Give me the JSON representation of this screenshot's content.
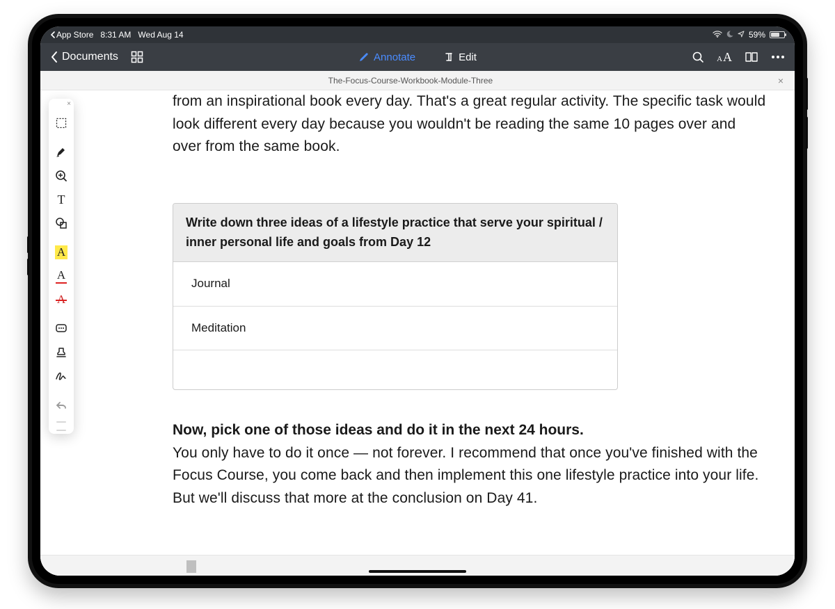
{
  "status": {
    "back_app": "App Store",
    "time": "8:31 AM",
    "date": "Wed Aug 14",
    "battery_pct": "59%"
  },
  "nav": {
    "back_label": "Documents",
    "annotate_label": "Annotate",
    "edit_label": "Edit"
  },
  "tab": {
    "title": "The-Focus-Course-Workbook-Module-Three"
  },
  "doc": {
    "p1": "from an inspirational book every day. That's a great regular activity. The specific task would look different every day because you wouldn't be reading the same 10 pages over and over from the same book.",
    "table_header": "Write down three ideas of a lifestyle practice that serve your spiritual / inner personal life and goals from Day 12",
    "rows": [
      "Journal",
      "Meditation",
      ""
    ],
    "bold": "Now, pick one of those ideas and do it in the next 24 hours.",
    "p2": "You only have to do it once — not forever. I recommend that once you've finished with the Focus Course, you come back and then implement this one lifestyle practice into your life. But we'll discuss that more at the conclusion on Day 41."
  },
  "tools": {
    "select": "select-region-icon",
    "highlighter": "highlighter-icon",
    "loupe": "loupe-icon",
    "text": "text-tool-icon",
    "shape": "shape-tool-icon",
    "highlight_text": "highlight-text-icon",
    "underline_text": "underline-text-icon",
    "strike_text": "strikethrough-text-icon",
    "note": "note-icon",
    "stamp": "stamp-icon",
    "signature": "signature-icon",
    "undo": "undo-icon",
    "letter": "A"
  }
}
